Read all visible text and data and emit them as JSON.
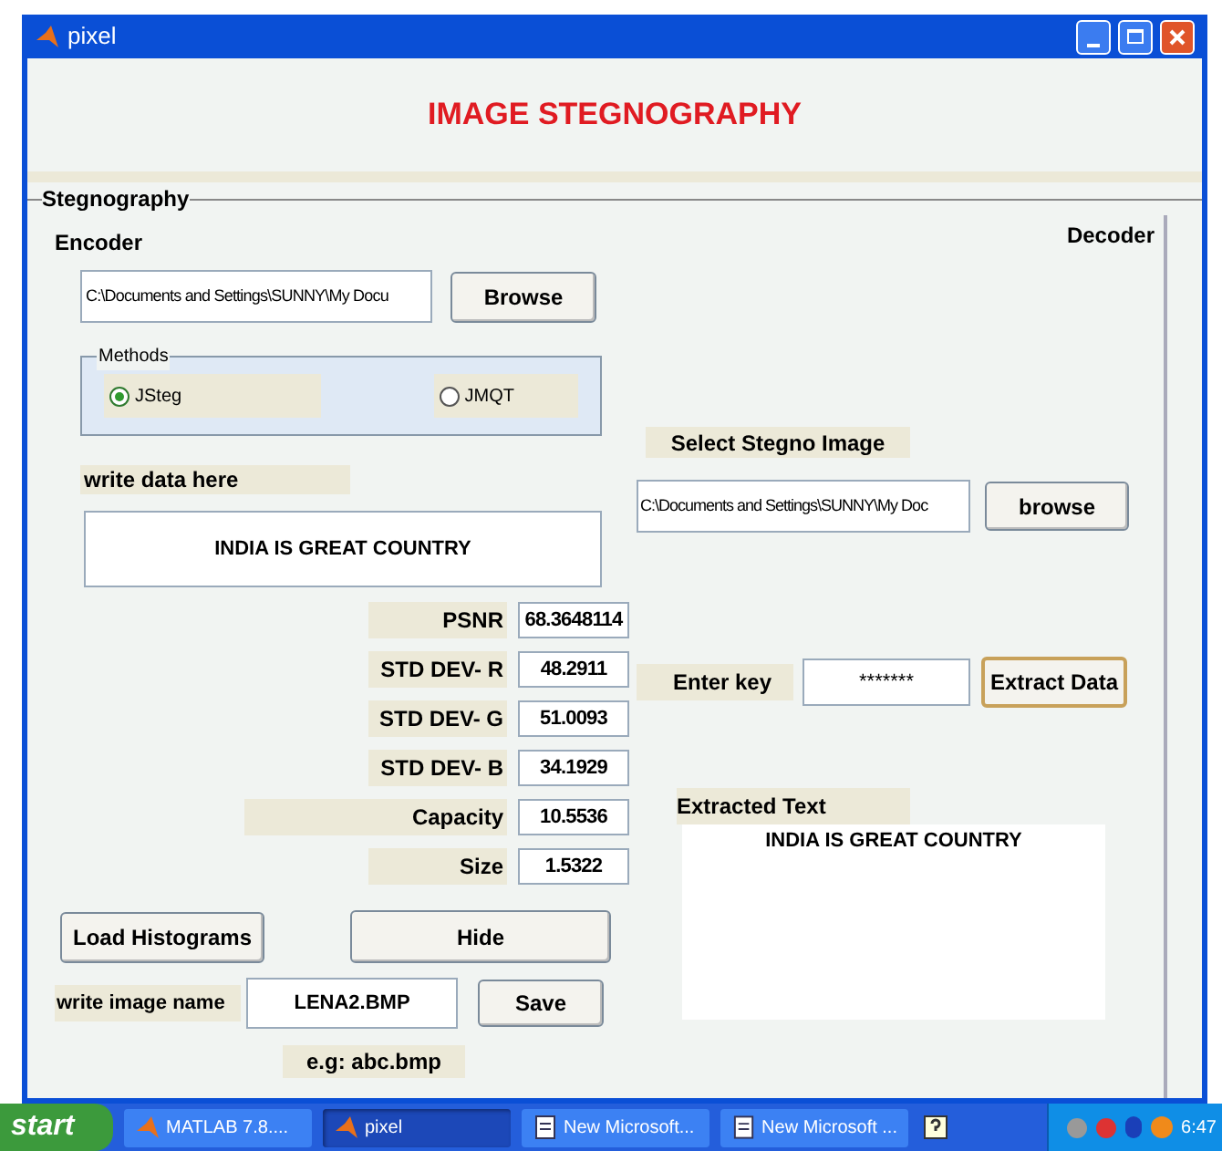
{
  "window": {
    "title": "pixel",
    "heading": "IMAGE STEGNOGRAPHY"
  },
  "panel": {
    "title": "Stegnography"
  },
  "encoder": {
    "title": "Encoder",
    "path": "C:\\Documents and Settings\\SUNNY\\My Docu",
    "browse": "Browse",
    "methods": {
      "title": "Methods",
      "options": [
        {
          "label": "JSteg",
          "selected": true
        },
        {
          "label": "JMQT",
          "selected": false
        }
      ]
    },
    "data_label": "write data here",
    "data_text": "INDIA IS GREAT COUNTRY",
    "metrics": [
      {
        "label": "PSNR",
        "value": "68.3648114"
      },
      {
        "label": "STD DEV- R",
        "value": "48.2911"
      },
      {
        "label": "STD DEV- G",
        "value": "51.0093"
      },
      {
        "label": "STD DEV- B",
        "value": "34.1929"
      },
      {
        "label": "Capacity",
        "value": "10.5536"
      },
      {
        "label": "Size",
        "value": "1.5322"
      }
    ],
    "load_button": "Load Histograms",
    "hide_button": "Hide",
    "image_name_label": "write image name",
    "image_name": "LENA2.BMP",
    "save_button": "Save",
    "hint": "e.g: abc.bmp"
  },
  "decoder": {
    "title": "Decoder",
    "select_label": "Select Stegno Image",
    "path": "C:\\Documents and Settings\\SUNNY\\My Doc",
    "browse": "browse",
    "key_label": "Enter key",
    "key": "*******",
    "extract_button": "Extract Data",
    "extracted_label": "Extracted Text",
    "extracted_text": "INDIA IS GREAT COUNTRY"
  },
  "taskbar": {
    "start": "start",
    "items": [
      {
        "label": "MATLAB 7.8....",
        "kind": "matlab",
        "selected": false
      },
      {
        "label": "pixel",
        "kind": "matlab",
        "selected": true
      },
      {
        "label": "New Microsoft...",
        "kind": "doc",
        "selected": false
      },
      {
        "label": "New Microsoft ...",
        "kind": "doc",
        "selected": false
      }
    ],
    "clock": "6:47"
  }
}
